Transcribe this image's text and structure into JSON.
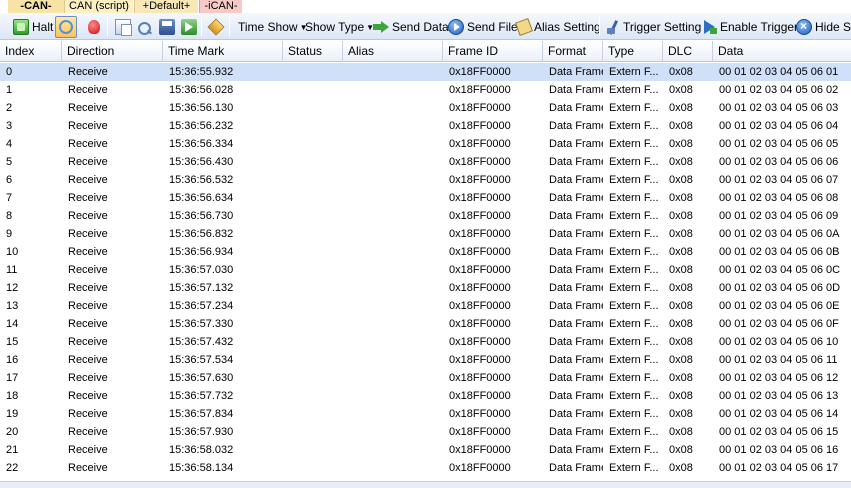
{
  "tabs": [
    {
      "label": "-CAN-",
      "active": true
    },
    {
      "label": "CAN (script)",
      "active": false
    },
    {
      "label": "+Default+",
      "active": false
    },
    {
      "label": "-iCAN-",
      "active": false
    }
  ],
  "toolbar": {
    "halt_label": "Halt",
    "time_show_label": "Time Show",
    "show_type_label": "Show Type",
    "send_data_label": "Send Data",
    "send_file_label": "Send File",
    "alias_setting_label": "Alias Setting",
    "trigger_setting_label": "Trigger Setting",
    "enable_trigger_label": "Enable Trigger",
    "hide_send_label": "Hide Ser"
  },
  "table": {
    "columns": [
      "Index",
      "Direction",
      "Time Mark",
      "Status",
      "Alias",
      "Frame ID",
      "Format",
      "Type",
      "DLC",
      "Data"
    ],
    "selected_row": 0,
    "rows": [
      {
        "index": "0",
        "direction": "Receive",
        "time": "15:36:55.932",
        "status": "",
        "alias": "",
        "frame_id": "0x18FF0000",
        "format": "Data Frame",
        "type": "Extern F...",
        "dlc": "0x08",
        "data": "00 01 02 03 04 05 06 01"
      },
      {
        "index": "1",
        "direction": "Receive",
        "time": "15:36:56.028",
        "status": "",
        "alias": "",
        "frame_id": "0x18FF0000",
        "format": "Data Frame",
        "type": "Extern F...",
        "dlc": "0x08",
        "data": "00 01 02 03 04 05 06 02"
      },
      {
        "index": "2",
        "direction": "Receive",
        "time": "15:36:56.130",
        "status": "",
        "alias": "",
        "frame_id": "0x18FF0000",
        "format": "Data Frame",
        "type": "Extern F...",
        "dlc": "0x08",
        "data": "00 01 02 03 04 05 06 03"
      },
      {
        "index": "3",
        "direction": "Receive",
        "time": "15:36:56.232",
        "status": "",
        "alias": "",
        "frame_id": "0x18FF0000",
        "format": "Data Frame",
        "type": "Extern F...",
        "dlc": "0x08",
        "data": "00 01 02 03 04 05 06 04"
      },
      {
        "index": "4",
        "direction": "Receive",
        "time": "15:36:56.334",
        "status": "",
        "alias": "",
        "frame_id": "0x18FF0000",
        "format": "Data Frame",
        "type": "Extern F...",
        "dlc": "0x08",
        "data": "00 01 02 03 04 05 06 05"
      },
      {
        "index": "5",
        "direction": "Receive",
        "time": "15:36:56.430",
        "status": "",
        "alias": "",
        "frame_id": "0x18FF0000",
        "format": "Data Frame",
        "type": "Extern F...",
        "dlc": "0x08",
        "data": "00 01 02 03 04 05 06 06"
      },
      {
        "index": "6",
        "direction": "Receive",
        "time": "15:36:56.532",
        "status": "",
        "alias": "",
        "frame_id": "0x18FF0000",
        "format": "Data Frame",
        "type": "Extern F...",
        "dlc": "0x08",
        "data": "00 01 02 03 04 05 06 07"
      },
      {
        "index": "7",
        "direction": "Receive",
        "time": "15:36:56.634",
        "status": "",
        "alias": "",
        "frame_id": "0x18FF0000",
        "format": "Data Frame",
        "type": "Extern F...",
        "dlc": "0x08",
        "data": "00 01 02 03 04 05 06 08"
      },
      {
        "index": "8",
        "direction": "Receive",
        "time": "15:36:56.730",
        "status": "",
        "alias": "",
        "frame_id": "0x18FF0000",
        "format": "Data Frame",
        "type": "Extern F...",
        "dlc": "0x08",
        "data": "00 01 02 03 04 05 06 09"
      },
      {
        "index": "9",
        "direction": "Receive",
        "time": "15:36:56.832",
        "status": "",
        "alias": "",
        "frame_id": "0x18FF0000",
        "format": "Data Frame",
        "type": "Extern F...",
        "dlc": "0x08",
        "data": "00 01 02 03 04 05 06 0A"
      },
      {
        "index": "10",
        "direction": "Receive",
        "time": "15:36:56.934",
        "status": "",
        "alias": "",
        "frame_id": "0x18FF0000",
        "format": "Data Frame",
        "type": "Extern F...",
        "dlc": "0x08",
        "data": "00 01 02 03 04 05 06 0B"
      },
      {
        "index": "11",
        "direction": "Receive",
        "time": "15:36:57.030",
        "status": "",
        "alias": "",
        "frame_id": "0x18FF0000",
        "format": "Data Frame",
        "type": "Extern F...",
        "dlc": "0x08",
        "data": "00 01 02 03 04 05 06 0C"
      },
      {
        "index": "12",
        "direction": "Receive",
        "time": "15:36:57.132",
        "status": "",
        "alias": "",
        "frame_id": "0x18FF0000",
        "format": "Data Frame",
        "type": "Extern F...",
        "dlc": "0x08",
        "data": "00 01 02 03 04 05 06 0D"
      },
      {
        "index": "13",
        "direction": "Receive",
        "time": "15:36:57.234",
        "status": "",
        "alias": "",
        "frame_id": "0x18FF0000",
        "format": "Data Frame",
        "type": "Extern F...",
        "dlc": "0x08",
        "data": "00 01 02 03 04 05 06 0E"
      },
      {
        "index": "14",
        "direction": "Receive",
        "time": "15:36:57.330",
        "status": "",
        "alias": "",
        "frame_id": "0x18FF0000",
        "format": "Data Frame",
        "type": "Extern F...",
        "dlc": "0x08",
        "data": "00 01 02 03 04 05 06 0F"
      },
      {
        "index": "15",
        "direction": "Receive",
        "time": "15:36:57.432",
        "status": "",
        "alias": "",
        "frame_id": "0x18FF0000",
        "format": "Data Frame",
        "type": "Extern F...",
        "dlc": "0x08",
        "data": "00 01 02 03 04 05 06 10"
      },
      {
        "index": "16",
        "direction": "Receive",
        "time": "15:36:57.534",
        "status": "",
        "alias": "",
        "frame_id": "0x18FF0000",
        "format": "Data Frame",
        "type": "Extern F...",
        "dlc": "0x08",
        "data": "00 01 02 03 04 05 06 11"
      },
      {
        "index": "17",
        "direction": "Receive",
        "time": "15:36:57.630",
        "status": "",
        "alias": "",
        "frame_id": "0x18FF0000",
        "format": "Data Frame",
        "type": "Extern F...",
        "dlc": "0x08",
        "data": "00 01 02 03 04 05 06 12"
      },
      {
        "index": "18",
        "direction": "Receive",
        "time": "15:36:57.732",
        "status": "",
        "alias": "",
        "frame_id": "0x18FF0000",
        "format": "Data Frame",
        "type": "Extern F...",
        "dlc": "0x08",
        "data": "00 01 02 03 04 05 06 13"
      },
      {
        "index": "19",
        "direction": "Receive",
        "time": "15:36:57.834",
        "status": "",
        "alias": "",
        "frame_id": "0x18FF0000",
        "format": "Data Frame",
        "type": "Extern F...",
        "dlc": "0x08",
        "data": "00 01 02 03 04 05 06 14"
      },
      {
        "index": "20",
        "direction": "Receive",
        "time": "15:36:57.930",
        "status": "",
        "alias": "",
        "frame_id": "0x18FF0000",
        "format": "Data Frame",
        "type": "Extern F...",
        "dlc": "0x08",
        "data": "00 01 02 03 04 05 06 15"
      },
      {
        "index": "21",
        "direction": "Receive",
        "time": "15:36:58.032",
        "status": "",
        "alias": "",
        "frame_id": "0x18FF0000",
        "format": "Data Frame",
        "type": "Extern F...",
        "dlc": "0x08",
        "data": "00 01 02 03 04 05 06 16"
      },
      {
        "index": "22",
        "direction": "Receive",
        "time": "15:36:58.134",
        "status": "",
        "alias": "",
        "frame_id": "0x18FF0000",
        "format": "Data Frame",
        "type": "Extern F...",
        "dlc": "0x08",
        "data": "00 01 02 03 04 05 06 17"
      }
    ]
  }
}
